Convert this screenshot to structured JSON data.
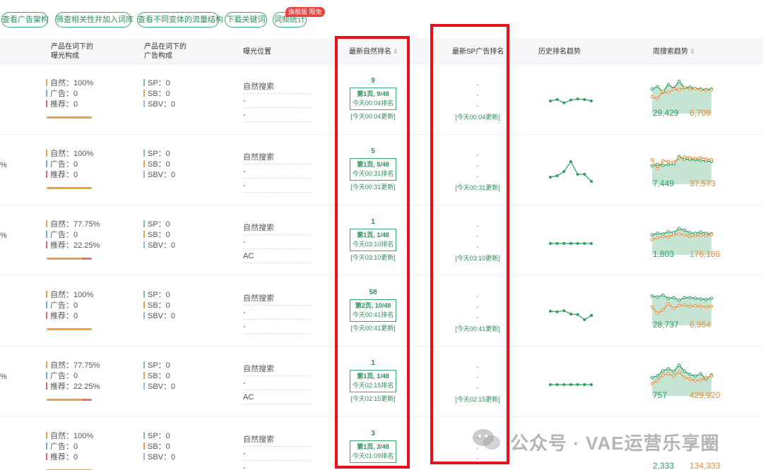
{
  "toolbar": {
    "buttons": [
      "查看广告架构",
      "筛查相关性并加入词库",
      "查看不同变体的流量结构",
      "下载关键词",
      "词频统计"
    ],
    "badge": "旗舰版 限免"
  },
  "header": {
    "col_mix": "产品在词下的\n曝光构成",
    "col_ad": "产品在词下的\n广告构成",
    "col_exp": "曝光位置",
    "col_rank": "最新自然排名",
    "col_sp": "最新SP广告排名",
    "col_hist": "历史排名趋势",
    "col_week": "周搜索趋势"
  },
  "rows": [
    {
      "pct": "",
      "natural": "自然：100%",
      "ad": "广告：0",
      "rec": "推荐：0",
      "sp": "SP：0",
      "sb": "SB：0",
      "sbv": "SBV：0",
      "exp": [
        "自然搜索",
        "-",
        "-"
      ],
      "rank_num": "9",
      "rank_page": "第1页, 9/48",
      "rank_time": "今天00:04排名",
      "rank_upd": "[今天00:04更新]",
      "sp_dashes": [
        "-",
        "-",
        "-"
      ],
      "sp_upd": "[今天00:04更新]",
      "hist": [
        55,
        60,
        48,
        58,
        62,
        60,
        55
      ],
      "week_a": [
        70,
        78,
        60,
        85,
        72,
        95,
        74,
        76,
        72,
        70,
        68,
        70
      ],
      "week_b": [
        45,
        40,
        62,
        58,
        70,
        68,
        75,
        70,
        72,
        68,
        66,
        68
      ],
      "wk_a": "29,429",
      "wk_b": "6,709",
      "mix_split": false
    },
    {
      "pct": "%",
      "natural": "自然：100%",
      "ad": "广告：0",
      "rec": "推荐：0",
      "sp": "SP：0",
      "sb": "SB：0",
      "sbv": "SBV：0",
      "exp": [
        "自然搜索",
        "-",
        "-"
      ],
      "rank_num": "5",
      "rank_page": "第1页, 5/48",
      "rank_time": "今天00:31排名",
      "rank_upd": "[今天00:31更新]",
      "sp_dashes": [
        "-",
        "-",
        "-"
      ],
      "sp_upd": "[今天00:31更新]",
      "hist": [
        35,
        40,
        55,
        90,
        45,
        45,
        20
      ],
      "week_a": [
        50,
        55,
        52,
        54,
        56,
        80,
        72,
        70,
        70,
        68,
        66,
        64
      ],
      "week_b": [
        70,
        40,
        66,
        64,
        62,
        74,
        78,
        76,
        74,
        76,
        72,
        70
      ],
      "wk_a": "7,449",
      "wk_b": "37,573",
      "mix_split": false
    },
    {
      "pct": "%",
      "natural": "自然：77.75%",
      "ad": "广告：0",
      "rec": "推荐：22.25%",
      "sp": "SP：0",
      "sb": "SB：0",
      "sbv": "SBV：0",
      "exp": [
        "自然搜索",
        "-",
        "AC"
      ],
      "rank_num": "1",
      "rank_page": "第1页, 1/48",
      "rank_time": "今天03:10排名",
      "rank_upd": "[今天03:10更新]",
      "sp_dashes": [
        "-",
        "-",
        "-"
      ],
      "sp_upd": "[今天03:10更新]",
      "hist": [
        50,
        50,
        50,
        50,
        50,
        50,
        50
      ],
      "week_a": [
        55,
        60,
        58,
        65,
        62,
        75,
        70,
        62,
        60,
        64,
        60,
        58
      ],
      "week_b": [
        40,
        45,
        50,
        48,
        55,
        58,
        55,
        50,
        52,
        54,
        52,
        56
      ],
      "wk_a": "1,803",
      "wk_b": "176,186",
      "mix_split": true
    },
    {
      "pct": "",
      "natural": "自然：100%",
      "ad": "广告：0",
      "rec": "推荐：0",
      "sp": "SP：0",
      "sb": "SB：0",
      "sbv": "SBV：0",
      "exp": [
        "自然搜索",
        "-",
        "-"
      ],
      "rank_num": "58",
      "rank_page": "第2页, 10/48",
      "rank_time": "今天00:41排名",
      "rank_upd": "[今天00:41更新]",
      "sp_dashes": [
        "-",
        "-",
        "-"
      ],
      "sp_upd": "[今天00:41更新]",
      "hist": [
        60,
        58,
        62,
        50,
        48,
        30,
        45
      ],
      "week_a": [
        85,
        82,
        88,
        78,
        80,
        72,
        80,
        80,
        78,
        76,
        74,
        78
      ],
      "week_b": [
        50,
        30,
        40,
        60,
        45,
        55,
        56,
        52,
        54,
        52,
        50,
        52
      ],
      "wk_a": "28,737",
      "wk_b": "6,964",
      "mix_split": false
    },
    {
      "pct": "%",
      "natural": "自然：77.75%",
      "ad": "广告：0",
      "rec": "推荐：22.25%",
      "sp": "SP：0",
      "sb": "SB：0",
      "sbv": "SBV：0",
      "exp": [
        "自然搜索",
        "-",
        "AC"
      ],
      "rank_num": "1",
      "rank_page": "第1页, 1/48",
      "rank_time": "今天02:15排名",
      "rank_upd": "[今天02:15更新]",
      "sp_dashes": [
        "-",
        "-",
        "-"
      ],
      "sp_upd": "[今天02:15更新]",
      "hist": [
        50,
        50,
        50,
        50,
        50,
        50,
        50
      ],
      "week_a": [
        50,
        55,
        72,
        78,
        70,
        90,
        70,
        60,
        55,
        62,
        45,
        58
      ],
      "week_b": [
        30,
        40,
        58,
        62,
        55,
        68,
        50,
        45,
        40,
        42,
        50,
        55
      ],
      "wk_a": "757",
      "wk_b": "429,920",
      "mix_split": true
    },
    {
      "pct": "",
      "natural": "自然：100%",
      "ad": "广告：0",
      "rec": "推荐：0",
      "sp": "SP：0",
      "sb": "SB：0",
      "sbv": "SBV：0",
      "exp": [
        "自然搜索",
        "-",
        "-"
      ],
      "rank_num": "3",
      "rank_page": "第1页, 3/48",
      "rank_time": "今天01:09排名",
      "rank_upd": "",
      "sp_dashes": [
        "-",
        "-",
        "-"
      ],
      "sp_upd": "",
      "hist": [],
      "week_a": [],
      "week_b": [],
      "wk_a": "2,333",
      "wk_b": "134,333",
      "mix_split": false
    }
  ],
  "watermark": "公众号 · VAE运营乐享圈",
  "colors": {
    "green": "#2e9e60",
    "orange": "#f08a35",
    "frame": "#e8111b"
  }
}
